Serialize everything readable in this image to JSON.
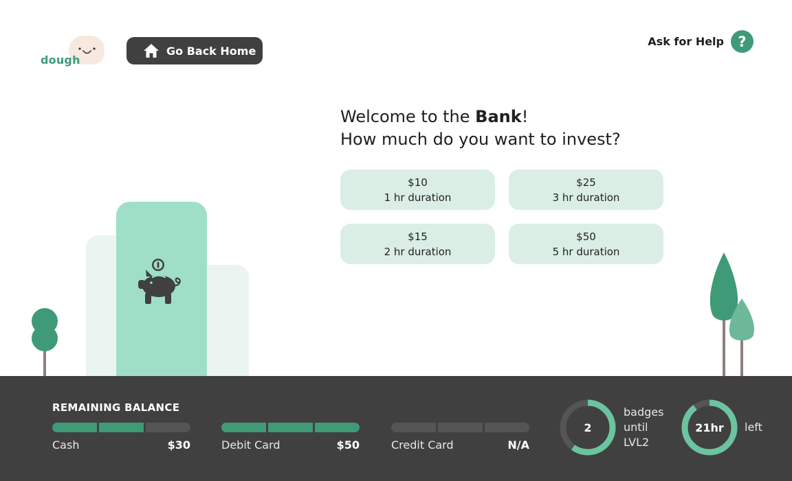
{
  "header": {
    "logo_text": "dough",
    "home_button": "Go Back Home",
    "help_label": "Ask for Help",
    "help_icon_text": "?"
  },
  "welcome": {
    "line1_prefix": "Welcome to the ",
    "line1_bold": "Bank",
    "line1_suffix": "!",
    "line2": "How much do you want to invest?"
  },
  "options": [
    {
      "amount": "$10",
      "duration": "1 hr duration"
    },
    {
      "amount": "$25",
      "duration": "3 hr duration"
    },
    {
      "amount": "$15",
      "duration": "2 hr duration"
    },
    {
      "amount": "$50",
      "duration": "5 hr duration"
    }
  ],
  "balance": {
    "title": "REMAINING BALANCE",
    "accounts": [
      {
        "label": "Cash",
        "value": "$30",
        "filled_segments": 2,
        "total_segments": 3
      },
      {
        "label": "Debit Card",
        "value": "$50",
        "filled_segments": 3,
        "total_segments": 3
      },
      {
        "label": "Credit Card",
        "value": "N/A",
        "filled_segments": 0,
        "total_segments": 3
      }
    ]
  },
  "badges": {
    "value": "2",
    "label": "badges until LVL2",
    "progress": 0.6
  },
  "time": {
    "value": "21hr",
    "label": "left",
    "progress": 0.9
  },
  "colors": {
    "accent": "#3f9a77",
    "ring_accent": "#6cc3a0",
    "bar_bg": "#404040",
    "option_bg": "#dbeee6",
    "building": "#9fdfc7"
  },
  "icons": {
    "home": "home-icon",
    "help": "question-mark-icon",
    "piggy": "piggy-bank-icon"
  }
}
